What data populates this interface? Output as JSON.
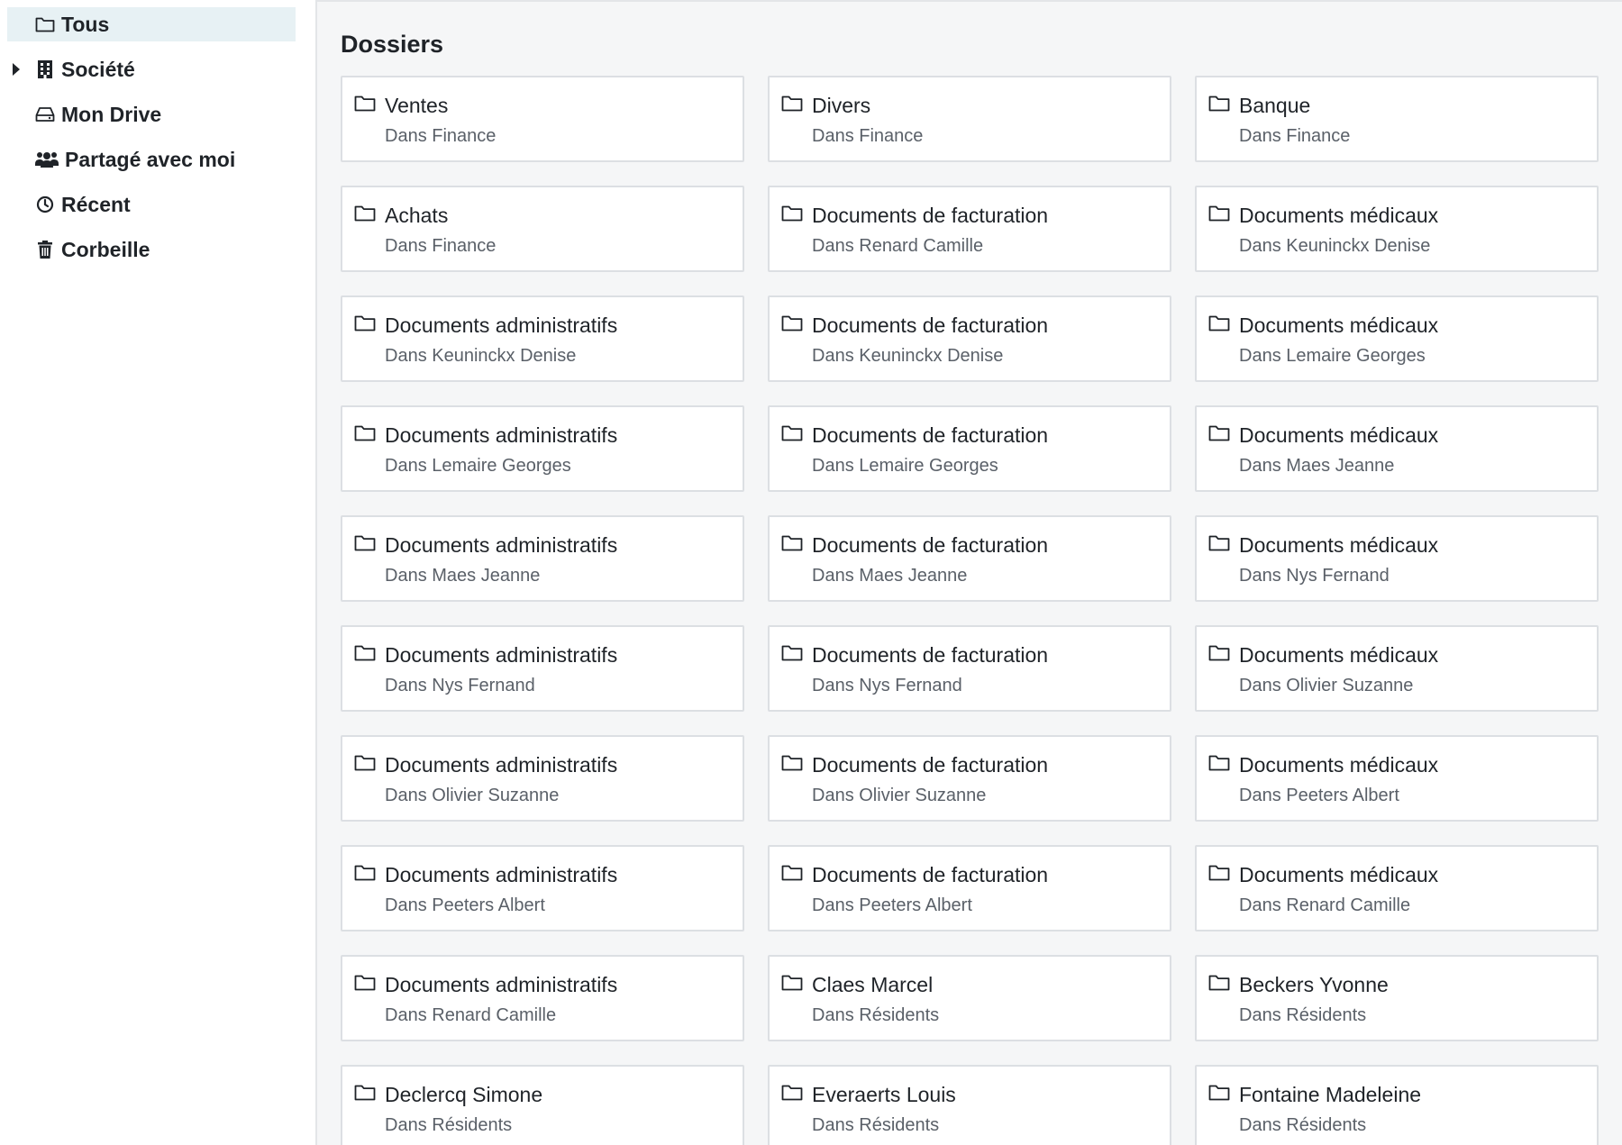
{
  "sidebar": {
    "items": [
      {
        "label": "Tous",
        "icon": "folder-icon",
        "active": true,
        "expandable": false
      },
      {
        "label": "Société",
        "icon": "building-icon",
        "active": false,
        "expandable": true
      },
      {
        "label": "Mon Drive",
        "icon": "hard-drive-icon",
        "active": false,
        "expandable": false
      },
      {
        "label": "Partagé avec moi",
        "icon": "users-icon",
        "active": false,
        "expandable": false
      },
      {
        "label": "Récent",
        "icon": "clock-icon",
        "active": false,
        "expandable": false
      },
      {
        "label": "Corbeille",
        "icon": "trash-icon",
        "active": false,
        "expandable": false
      }
    ]
  },
  "main": {
    "title": "Dossiers",
    "folders": [
      {
        "name": "Ventes",
        "location": "Dans Finance"
      },
      {
        "name": "Divers",
        "location": "Dans Finance"
      },
      {
        "name": "Banque",
        "location": "Dans Finance"
      },
      {
        "name": "Achats",
        "location": "Dans Finance"
      },
      {
        "name": "Documents de facturation",
        "location": "Dans Renard Camille"
      },
      {
        "name": "Documents médicaux",
        "location": "Dans Keuninckx Denise"
      },
      {
        "name": "Documents administratifs",
        "location": "Dans Keuninckx Denise"
      },
      {
        "name": "Documents de facturation",
        "location": "Dans Keuninckx Denise"
      },
      {
        "name": "Documents médicaux",
        "location": "Dans Lemaire Georges"
      },
      {
        "name": "Documents administratifs",
        "location": "Dans Lemaire Georges"
      },
      {
        "name": "Documents de facturation",
        "location": "Dans Lemaire Georges"
      },
      {
        "name": "Documents médicaux",
        "location": "Dans Maes Jeanne"
      },
      {
        "name": "Documents administratifs",
        "location": "Dans Maes Jeanne"
      },
      {
        "name": "Documents de facturation",
        "location": "Dans Maes Jeanne"
      },
      {
        "name": "Documents médicaux",
        "location": "Dans Nys Fernand"
      },
      {
        "name": "Documents administratifs",
        "location": "Dans Nys Fernand"
      },
      {
        "name": "Documents de facturation",
        "location": "Dans Nys Fernand"
      },
      {
        "name": "Documents médicaux",
        "location": "Dans Olivier Suzanne"
      },
      {
        "name": "Documents administratifs",
        "location": "Dans Olivier Suzanne"
      },
      {
        "name": "Documents de facturation",
        "location": "Dans Olivier Suzanne"
      },
      {
        "name": "Documents médicaux",
        "location": "Dans Peeters Albert"
      },
      {
        "name": "Documents administratifs",
        "location": "Dans Peeters Albert"
      },
      {
        "name": "Documents de facturation",
        "location": "Dans Peeters Albert"
      },
      {
        "name": "Documents médicaux",
        "location": "Dans Renard Camille"
      },
      {
        "name": "Documents administratifs",
        "location": "Dans Renard Camille"
      },
      {
        "name": "Claes Marcel",
        "location": "Dans Résidents"
      },
      {
        "name": "Beckers Yvonne",
        "location": "Dans Résidents"
      },
      {
        "name": "Declercq Simone",
        "location": "Dans Résidents"
      },
      {
        "name": "Everaerts Louis",
        "location": "Dans Résidents"
      },
      {
        "name": "Fontaine Madeleine",
        "location": "Dans Résidents"
      }
    ]
  }
}
